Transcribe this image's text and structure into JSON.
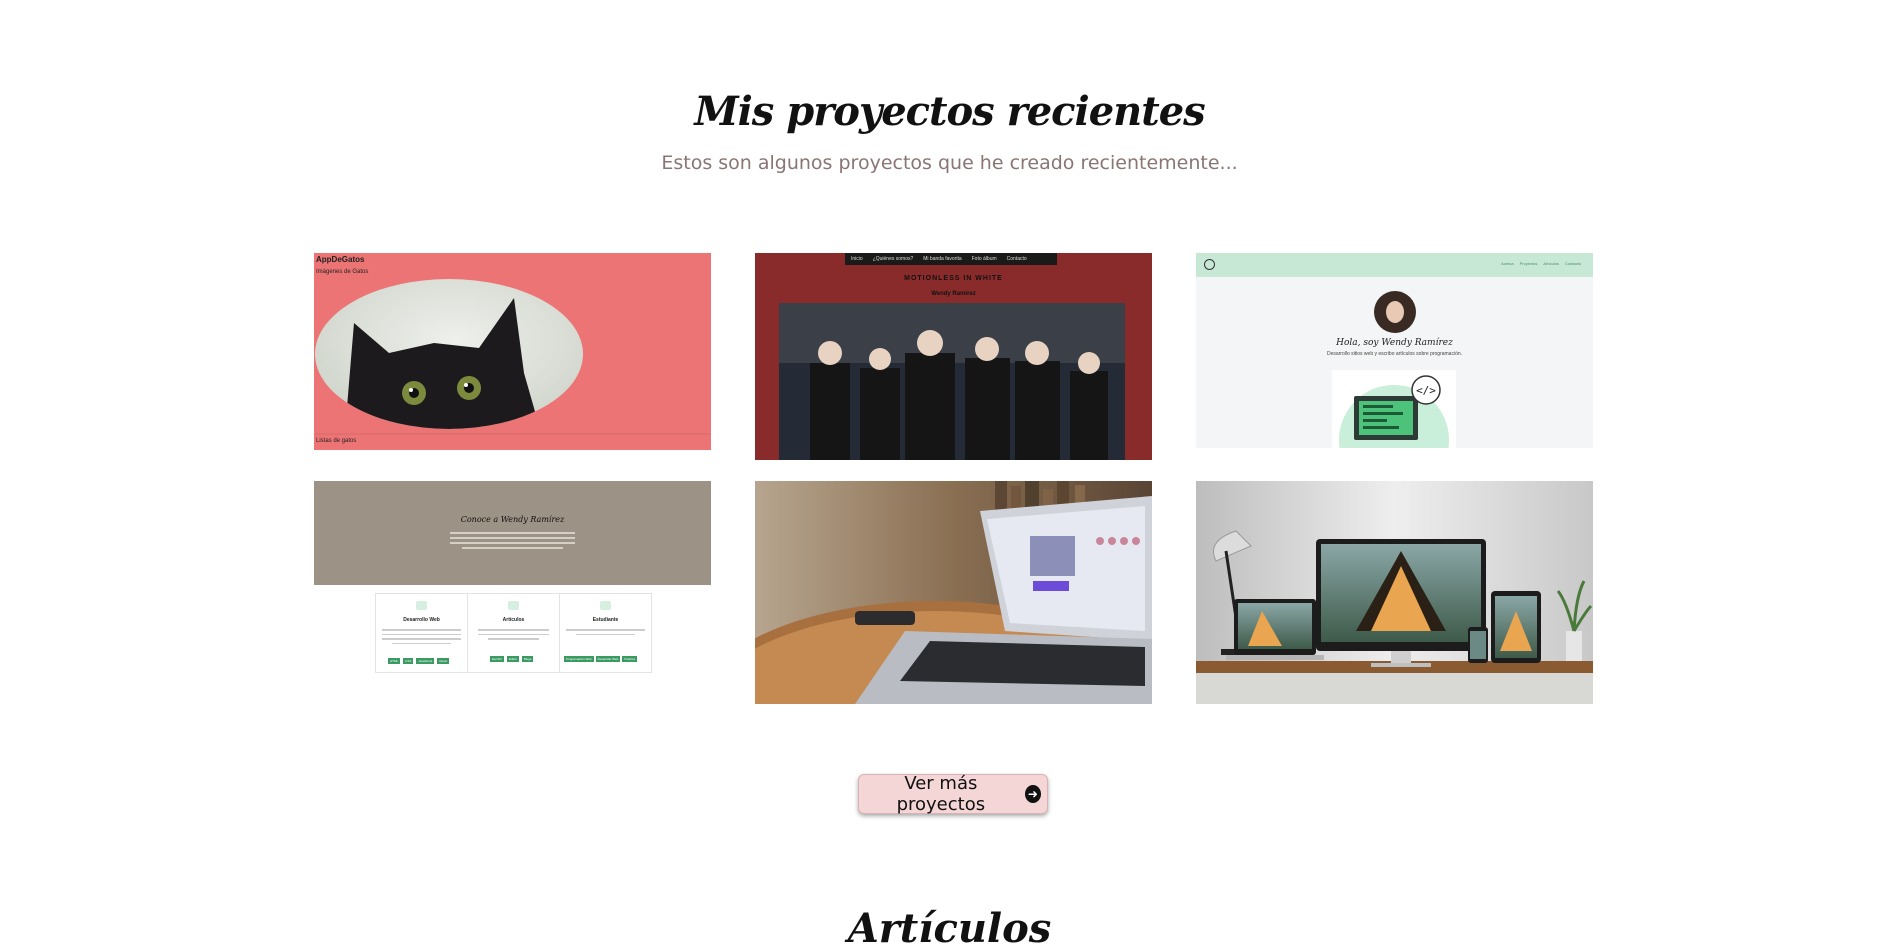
{
  "section": {
    "title": "Mis proyectos recientes",
    "subtitle": "Estos son algunos proyectos que he creado recientemente..."
  },
  "projects": {
    "p1": {
      "app_title": "AppDeGatos",
      "app_subtitle": "Imágenes de Gatos",
      "footer": "Listas de gatos",
      "icon": "cat-photo"
    },
    "p2": {
      "nav": [
        "Inicio",
        "¿Quiénes somos?",
        "Mi banda favorita",
        "Foto álbum",
        "Contacto"
      ],
      "band_title": "MOTIONLESS IN WHITE",
      "band_sub": "Wendy Ramirez"
    },
    "p3": {
      "nav": [
        "Acerca",
        "Proyectos",
        "Artículos",
        "Contacto"
      ],
      "heading": "Hola, soy Wendy Ramírez",
      "desc": "Desarrollo sitios web y escribo artículos sobre programación."
    },
    "p4": {
      "heading": "Conoce a Wendy Ramírez",
      "cards": [
        {
          "title": "Desarrollo Web",
          "tags": [
            "HTML",
            "CSS",
            "JavaScript",
            "React"
          ]
        },
        {
          "title": "Artículos",
          "tags": [
            "Escribir",
            "Editar",
            "Blogs"
          ]
        },
        {
          "title": "Estudiante",
          "tags": [
            "Programación Web",
            "Desarrollo Web",
            "Práctica"
          ]
        }
      ]
    },
    "p5": {
      "icon": "laptop-photo"
    },
    "p6": {
      "icon": "responsive-devices-photo"
    }
  },
  "more_button": {
    "label": "Ver más proyectos",
    "icon": "arrow-right-circle-icon"
  },
  "next_section": {
    "title": "Artículos"
  }
}
